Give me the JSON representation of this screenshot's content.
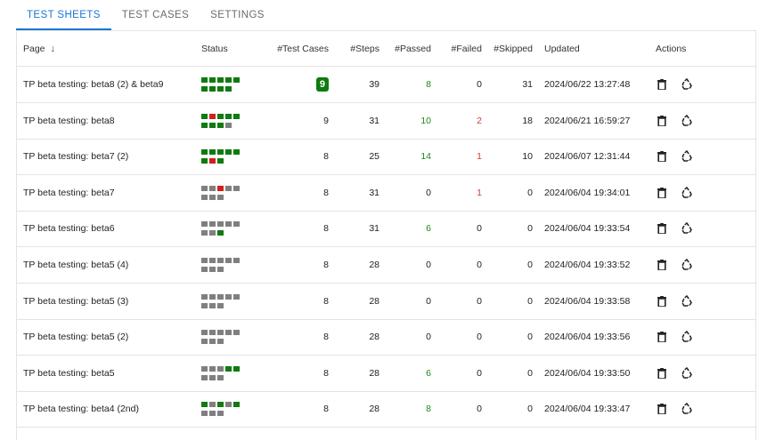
{
  "tabs": [
    {
      "label": "TEST SHEETS",
      "active": true
    },
    {
      "label": "TEST CASES",
      "active": false
    },
    {
      "label": "SETTINGS",
      "active": false
    }
  ],
  "columns": {
    "page": "Page",
    "status": "Status",
    "test_cases": "#Test Cases",
    "steps": "#Steps",
    "passed": "#Passed",
    "failed": "#Failed",
    "skipped": "#Skipped",
    "updated": "Updated",
    "actions": "Actions"
  },
  "sort_icon": "arrow-down-icon",
  "colors": {
    "accent": "#1976d2",
    "passed": "#0f7a0f",
    "failed": "#d11f1f",
    "skipped": "#7f7f7f"
  },
  "rows": [
    {
      "page": "TP beta testing: beta8 (2) & beta9",
      "status": [
        "passed",
        "passed",
        "passed",
        "passed",
        "passed",
        "passed",
        "passed",
        "passed",
        "passed"
      ],
      "test_cases": "9",
      "highlight": true,
      "steps": "39",
      "passed": "8",
      "failed": "0",
      "skipped": "31",
      "updated": "2024/06/22 13:27:48"
    },
    {
      "page": "TP beta testing: beta8",
      "status": [
        "passed",
        "failed",
        "passed",
        "passed",
        "passed",
        "passed",
        "passed",
        "passed",
        "skipped"
      ],
      "test_cases": "9",
      "highlight": false,
      "steps": "31",
      "passed": "10",
      "failed": "2",
      "skipped": "18",
      "updated": "2024/06/21 16:59:27"
    },
    {
      "page": "TP beta testing: beta7 (2)",
      "status": [
        "passed",
        "passed",
        "passed",
        "passed",
        "passed",
        "passed",
        "failed",
        "passed"
      ],
      "test_cases": "8",
      "highlight": false,
      "steps": "25",
      "passed": "14",
      "failed": "1",
      "skipped": "10",
      "updated": "2024/06/07 12:31:44"
    },
    {
      "page": "TP beta testing: beta7",
      "status": [
        "skipped",
        "skipped",
        "failed",
        "skipped",
        "skipped",
        "skipped",
        "skipped",
        "skipped"
      ],
      "test_cases": "8",
      "highlight": false,
      "steps": "31",
      "passed": "0",
      "failed": "1",
      "skipped": "0",
      "updated": "2024/06/04 19:34:01"
    },
    {
      "page": "TP beta testing: beta6",
      "status": [
        "skipped",
        "skipped",
        "skipped",
        "skipped",
        "skipped",
        "skipped",
        "skipped",
        "passed"
      ],
      "test_cases": "8",
      "highlight": false,
      "steps": "31",
      "passed": "6",
      "failed": "0",
      "skipped": "0",
      "updated": "2024/06/04 19:33:54"
    },
    {
      "page": "TP beta testing: beta5 (4)",
      "status": [
        "skipped",
        "skipped",
        "skipped",
        "skipped",
        "skipped",
        "skipped",
        "skipped",
        "skipped"
      ],
      "test_cases": "8",
      "highlight": false,
      "steps": "28",
      "passed": "0",
      "failed": "0",
      "skipped": "0",
      "updated": "2024/06/04 19:33:52"
    },
    {
      "page": "TP beta testing: beta5 (3)",
      "status": [
        "skipped",
        "skipped",
        "skipped",
        "skipped",
        "skipped",
        "skipped",
        "skipped",
        "skipped"
      ],
      "test_cases": "8",
      "highlight": false,
      "steps": "28",
      "passed": "0",
      "failed": "0",
      "skipped": "0",
      "updated": "2024/06/04 19:33:58"
    },
    {
      "page": "TP beta testing: beta5 (2)",
      "status": [
        "skipped",
        "skipped",
        "skipped",
        "skipped",
        "skipped",
        "skipped",
        "skipped",
        "skipped"
      ],
      "test_cases": "8",
      "highlight": false,
      "steps": "28",
      "passed": "0",
      "failed": "0",
      "skipped": "0",
      "updated": "2024/06/04 19:33:56"
    },
    {
      "page": "TP beta testing: beta5",
      "status": [
        "skipped",
        "skipped",
        "skipped",
        "passed",
        "passed",
        "skipped",
        "skipped",
        "skipped"
      ],
      "test_cases": "8",
      "highlight": false,
      "steps": "28",
      "passed": "6",
      "failed": "0",
      "skipped": "0",
      "updated": "2024/06/04 19:33:50"
    },
    {
      "page": "TP beta testing: beta4 (2nd)",
      "status": [
        "passed",
        "skipped",
        "passed",
        "skipped",
        "passed",
        "skipped",
        "skipped",
        "skipped"
      ],
      "test_cases": "8",
      "highlight": false,
      "steps": "28",
      "passed": "8",
      "failed": "0",
      "skipped": "0",
      "updated": "2024/06/04 19:33:47"
    }
  ],
  "actions": {
    "delete_icon": "trash-icon",
    "reset_icon": "recycle-icon"
  }
}
